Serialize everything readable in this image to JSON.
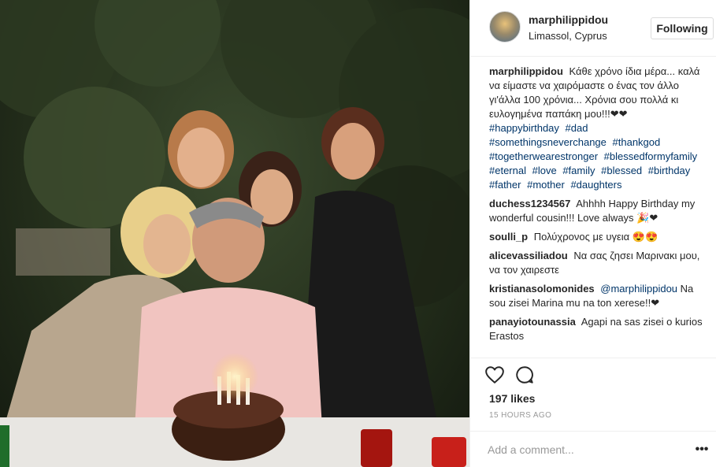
{
  "post": {
    "owner": "marphilippidou",
    "location": "Limassol, Cyprus",
    "follow_label": "Following",
    "avatar": "avatar-photo"
  },
  "caption": {
    "user": "marphilippidou",
    "text": "Κάθε χρόνο ίδια μέρα... καλά να είμαστε να χαιρόμαστε ο ένας τον άλλο γι'άλλα 100 χρόνια... Χρόνια σου πολλά κι ευλογημένα παπάκη μου!!!❤❤",
    "hashtags": [
      "#happybirthday",
      "#dad",
      "#somethingsneverchange",
      "#thankgod",
      "#togetherwearestronger",
      "#blessedformyfamily",
      "#eternal",
      "#love",
      "#family",
      "#blessed",
      "#birthday",
      "#father",
      "#mother",
      "#daughters"
    ]
  },
  "comments": [
    {
      "user": "duchess1234567",
      "text": "Ahhhh Happy Birthday my wonderful cousin!!! Love always 🎉❤",
      "mention": ""
    },
    {
      "user": "soulli_p",
      "text": "Πολύχρονος με υγεια 😍😍",
      "mention": ""
    },
    {
      "user": "alicevassiliadou",
      "text": "Να σας ζησει Μαρινακι μου, να τον χαιρεστε",
      "mention": ""
    },
    {
      "user": "kristianasolomonides",
      "mention": "@marphilippidou",
      "text": "Na sou zisei Marina mu na ton xerese!!❤"
    },
    {
      "user": "panayiotounassia",
      "text": "Agapi na sas zisei o kurios Erastos",
      "mention": ""
    }
  ],
  "actions": {
    "like_icon": "heart-icon",
    "comment_icon": "comment-icon",
    "likes": "197 likes",
    "timestamp": "15 HOURS AGO"
  },
  "add_comment": {
    "placeholder": "Add a comment...",
    "more_label": "•••"
  },
  "colors": {
    "link": "#003569",
    "text": "#262626",
    "muted": "#999999",
    "border": "#efefef"
  }
}
